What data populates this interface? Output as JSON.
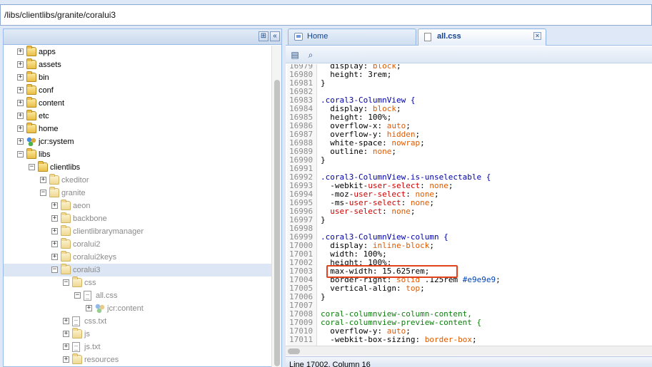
{
  "path_bar": {
    "value": "/libs/clientlibs/granite/coralui3"
  },
  "tree": {
    "items": [
      {
        "label": "apps",
        "icon": "folder-icon"
      },
      {
        "label": "assets",
        "icon": "folder-icon"
      },
      {
        "label": "bin",
        "icon": "folder-icon"
      },
      {
        "label": "conf",
        "icon": "folder-icon"
      },
      {
        "label": "content",
        "icon": "folder-icon"
      },
      {
        "label": "etc",
        "icon": "folder-icon"
      },
      {
        "label": "home",
        "icon": "folder-icon"
      },
      {
        "label": "jcr:system",
        "icon": "node-icon"
      },
      {
        "label": "libs",
        "icon": "folder-icon"
      },
      {
        "label": "clientlibs",
        "icon": "folder-icon"
      },
      {
        "label": "ckeditor",
        "icon": "folder-icon"
      },
      {
        "label": "granite",
        "icon": "folder-icon"
      },
      {
        "label": "aeon",
        "icon": "folder-icon"
      },
      {
        "label": "backbone",
        "icon": "folder-icon"
      },
      {
        "label": "clientlibrarymanager",
        "icon": "folder-icon"
      },
      {
        "label": "coralui2",
        "icon": "folder-icon"
      },
      {
        "label": "coralui2keys",
        "icon": "folder-icon"
      },
      {
        "label": "coralui3",
        "icon": "folder-icon"
      },
      {
        "label": "css",
        "icon": "folder-icon"
      },
      {
        "label": "all.css",
        "icon": "file-icon"
      },
      {
        "label": "jcr:content",
        "icon": "node-icon"
      },
      {
        "label": "css.txt",
        "icon": "file-icon"
      },
      {
        "label": "js",
        "icon": "folder-icon"
      },
      {
        "label": "js.txt",
        "icon": "file-icon"
      },
      {
        "label": "resources",
        "icon": "folder-icon"
      }
    ]
  },
  "tabs": [
    {
      "label": "Home"
    },
    {
      "label": "all.css"
    }
  ],
  "editor": {
    "lines": [
      {
        "n": "16979",
        "code": "  display: block;"
      },
      {
        "n": "16980",
        "code": "  height: 3rem;"
      },
      {
        "n": "16981",
        "code": "}"
      },
      {
        "n": "16982",
        "code": ""
      },
      {
        "n": "16983",
        "code": ".coral3-ColumnView {"
      },
      {
        "n": "16984",
        "code": "  display: block;"
      },
      {
        "n": "16985",
        "code": "  height: 100%;"
      },
      {
        "n": "16986",
        "code": "  overflow-x: auto;"
      },
      {
        "n": "16987",
        "code": "  overflow-y: hidden;"
      },
      {
        "n": "16988",
        "code": "  white-space: nowrap;"
      },
      {
        "n": "16989",
        "code": "  outline: none;"
      },
      {
        "n": "16990",
        "code": "}"
      },
      {
        "n": "16991",
        "code": ""
      },
      {
        "n": "16992",
        "code": ".coral3-ColumnView.is-unselectable {"
      },
      {
        "n": "16993",
        "code": "  -webkit-user-select: none;"
      },
      {
        "n": "16994",
        "code": "  -moz-user-select: none;"
      },
      {
        "n": "16995",
        "code": "  -ms-user-select: none;"
      },
      {
        "n": "16996",
        "code": "  user-select: none;"
      },
      {
        "n": "16997",
        "code": "}"
      },
      {
        "n": "16998",
        "code": ""
      },
      {
        "n": "16999",
        "code": ".coral3-ColumnView-column {"
      },
      {
        "n": "17000",
        "code": "  display: inline-block;"
      },
      {
        "n": "17001",
        "code": "  width: 100%;"
      },
      {
        "n": "17002",
        "code": "  height: 100%;"
      },
      {
        "n": "17003",
        "code": "  max-width: 15.625rem;"
      },
      {
        "n": "17004",
        "code": "  border-right: solid .125rem #e9e9e9;"
      },
      {
        "n": "17005",
        "code": "  vertical-align: top;"
      },
      {
        "n": "17006",
        "code": "}"
      },
      {
        "n": "17007",
        "code": ""
      },
      {
        "n": "17008",
        "code": "coral-columnview-column-content,"
      },
      {
        "n": "17009",
        "code": "coral-columnview-preview-content {"
      },
      {
        "n": "17010",
        "code": "  overflow-y: auto;"
      },
      {
        "n": "17011",
        "code": "  -webkit-box-sizing: border-box;"
      }
    ]
  },
  "status": {
    "text": "Line 17002, Column 16"
  },
  "colors": {
    "selector": "#0000aa",
    "keyword_value": "#e05a00",
    "vendor_prop": "#d00000",
    "highlight": "#e2431d"
  }
}
